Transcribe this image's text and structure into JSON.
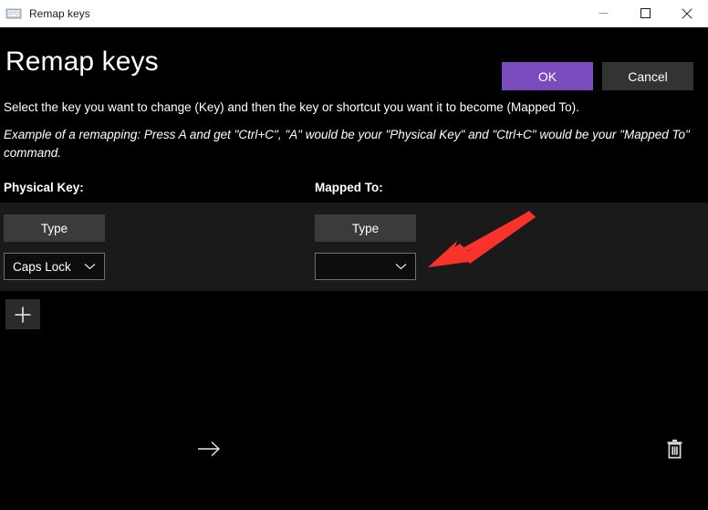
{
  "window": {
    "title": "Remap keys",
    "icon": "keyboard-icon",
    "controls": {
      "minimize": "minimize-icon",
      "maximize": "maximize-icon",
      "close": "close-icon"
    }
  },
  "header": {
    "title": "Remap keys",
    "ok_label": "OK",
    "cancel_label": "Cancel",
    "ok_color": "#7a4bbd",
    "cancel_color": "#333333"
  },
  "body": {
    "description": "Select the key you want to change (Key) and then the key or shortcut you want it to become (Mapped To).",
    "example": "Example of a remapping: Press A and get \"Ctrl+C\", \"A\" would be your \"Physical Key\" and \"Ctrl+C\" would be your \"Mapped To\" command."
  },
  "columns": {
    "physical_key_label": "Physical Key:",
    "mapped_to_label": "Mapped To:"
  },
  "row": {
    "physical": {
      "type_button_label": "Type",
      "dropdown_value": "Caps Lock",
      "dropdown_icon": "chevron-down-icon"
    },
    "mapped": {
      "type_button_label": "Type",
      "dropdown_value": "",
      "dropdown_icon": "chevron-down-icon"
    },
    "separator_icon": "arrow-right-icon",
    "delete_icon": "trash-icon"
  },
  "add_row": {
    "icon": "plus-icon"
  },
  "annotation": {
    "type": "arrow",
    "color": "#f9322c",
    "points_to": "mapped-to-dropdown"
  }
}
